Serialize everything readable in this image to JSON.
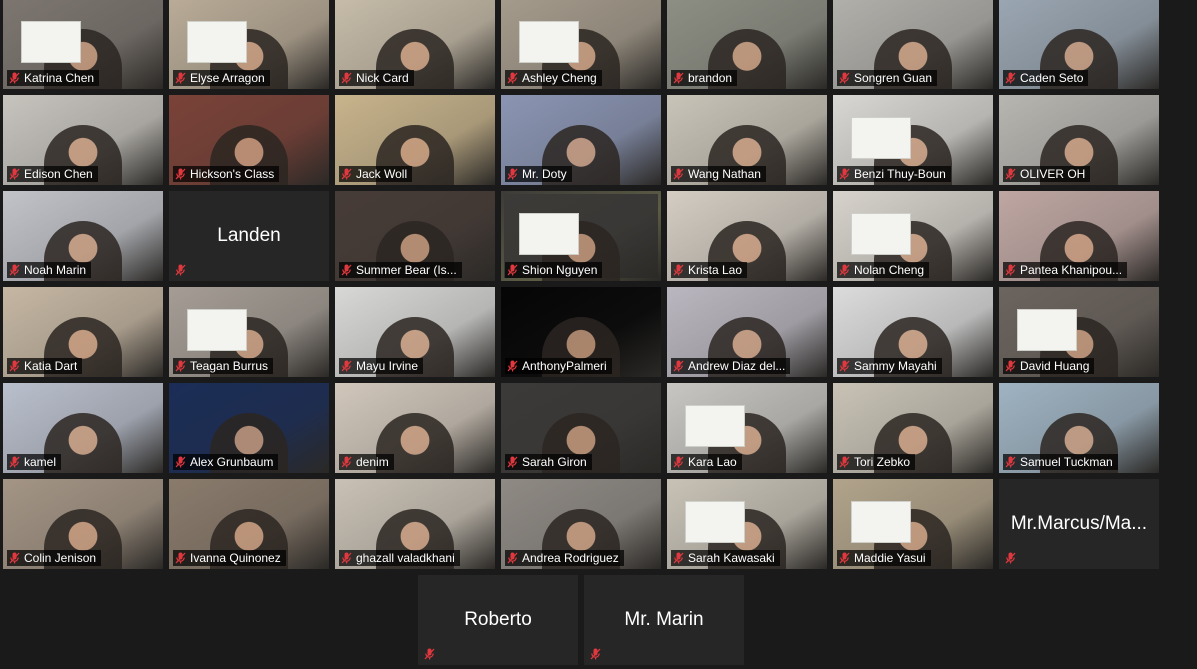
{
  "meeting": {
    "colors": {
      "background": "#1a1a1a",
      "tile_bg": "#2a2a2a",
      "placeholder_bg": "#262626",
      "active_speaker": "#d8e17a",
      "muted_icon": "#e0383e"
    },
    "rows": [
      [
        {
          "name": "Katrina Chen",
          "video": true,
          "bg": "#7d7670",
          "paper": true
        },
        {
          "name": "Elyse Arragon",
          "video": true,
          "bg": "#b9ab97",
          "paper": true
        },
        {
          "name": "Nick Card",
          "video": true,
          "bg": "#c7bca9"
        },
        {
          "name": "Ashley Cheng",
          "video": true,
          "bg": "#a59b8c",
          "paper": true
        },
        {
          "name": "brandon",
          "video": true,
          "bg": "#8d8f84"
        },
        {
          "name": "Songren Guan",
          "video": true,
          "bg": "#b2b0ab"
        },
        {
          "name": "Caden Seto",
          "video": true,
          "bg": "#9aa6b2"
        }
      ],
      [
        {
          "name": "Edison Chen",
          "video": true,
          "bg": "#c7c4be"
        },
        {
          "name": "Hickson's Class",
          "video": true,
          "bg": "#7a4238"
        },
        {
          "name": "Jack Woll",
          "video": true,
          "bg": "#c8b48c"
        },
        {
          "name": "Mr. Doty",
          "video": true,
          "bg": "#8b95b3"
        },
        {
          "name": "Wang Nathan",
          "video": true,
          "bg": "#c9c4b8"
        },
        {
          "name": "Benzi Thuy-Boun",
          "video": true,
          "bg": "#d9d7d3",
          "paper": true
        },
        {
          "name": "OLIVER OH",
          "video": true,
          "bg": "#b8b6b1"
        }
      ],
      [
        {
          "name": "Noah Marin",
          "video": true,
          "bg": "#c1c3c9"
        },
        {
          "name": "Landen",
          "video": false
        },
        {
          "name": "Summer Bear (Is...",
          "video": true,
          "bg": "#473c37"
        },
        {
          "name": "Shion Nguyen",
          "video": true,
          "bg": "#3d3b38",
          "paper": true,
          "active": true
        },
        {
          "name": "Krista Lao",
          "video": true,
          "bg": "#d4cdc3"
        },
        {
          "name": "Nolan Cheng",
          "video": true,
          "bg": "#d7d3cc",
          "paper": true
        },
        {
          "name": "Pantea Khanipou...",
          "video": true,
          "bg": "#bfa7a3"
        }
      ],
      [
        {
          "name": "Katia Dart",
          "video": true,
          "bg": "#c6b7a3"
        },
        {
          "name": "Teagan Burrus",
          "video": true,
          "bg": "#a59d95",
          "paper": true
        },
        {
          "name": "Mayu Irvine",
          "video": true,
          "bg": "#d8d8d6"
        },
        {
          "name": "AnthonyPalmeri",
          "video": true,
          "bg": "#050505"
        },
        {
          "name": "Andrew Diaz del...",
          "video": true,
          "bg": "#bbb7c0"
        },
        {
          "name": "Sammy Mayahi",
          "video": true,
          "bg": "#dcdcdc"
        },
        {
          "name": "David Huang",
          "video": true,
          "bg": "#6c645e",
          "paper": true
        }
      ],
      [
        {
          "name": "kamel",
          "video": true,
          "bg": "#b9bfcc"
        },
        {
          "name": "Alex Grunbaum",
          "video": true,
          "bg": "#1b2d57"
        },
        {
          "name": "denim",
          "video": true,
          "bg": "#d1c7bb"
        },
        {
          "name": "Sarah Giron",
          "video": true,
          "bg": "#3c3a38"
        },
        {
          "name": "Kara Lao",
          "video": true,
          "bg": "#c8c6c2",
          "paper": true
        },
        {
          "name": "Tori Zebko",
          "video": true,
          "bg": "#c9c3b6"
        },
        {
          "name": "Samuel Tuckman",
          "video": true,
          "bg": "#9fb3c2"
        }
      ],
      [
        {
          "name": "Colin Jenison",
          "video": true,
          "bg": "#a49585"
        },
        {
          "name": "Ivanna Quinonez",
          "video": true,
          "bg": "#8a7b6c"
        },
        {
          "name": "ghazall valadkhani",
          "video": true,
          "bg": "#c9c1b5"
        },
        {
          "name": "Andrea Rodriguez",
          "video": true,
          "bg": "#8f8a84"
        },
        {
          "name": "Sarah Kawasaki",
          "video": true,
          "bg": "#c8c2b6",
          "paper": true
        },
        {
          "name": "Maddie Yasui",
          "video": true,
          "bg": "#b2a48b",
          "paper": true
        },
        {
          "name": "Mr.Marcus/Ma...",
          "video": false
        }
      ]
    ],
    "bottom_row": [
      {
        "name": "Roberto",
        "video": false
      },
      {
        "name": "Mr. Marin",
        "video": false
      }
    ]
  }
}
